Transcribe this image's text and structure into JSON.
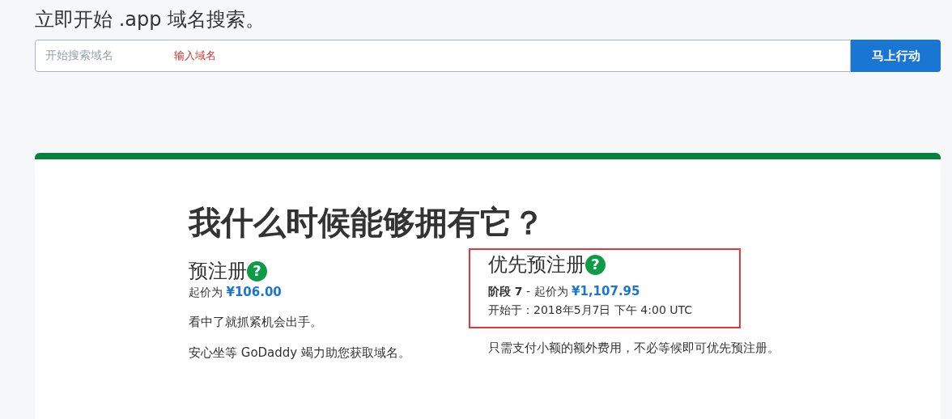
{
  "search": {
    "title": "立即开始 .app 域名搜索。",
    "placeholder": "开始搜索域名",
    "annotation": "输入域名",
    "button": "马上行动"
  },
  "card": {
    "heading": "我什么时候能够拥有它？",
    "plans": [
      {
        "title": "预注册",
        "help_icon": "?",
        "price_label": "起价为",
        "price": "¥106.00",
        "highlighted": false,
        "descriptions": [
          "看中了就抓紧机会出手。",
          "安心坐等 GoDaddy 竭力助您获取域名。"
        ]
      },
      {
        "title": "优先预注册",
        "help_icon": "?",
        "price_label": "**阶段 7** - 起价为",
        "price": "¥1,107.95",
        "start": "开始于：2018年5月7日 下午 4:00 UTC",
        "highlighted": true,
        "descriptions": [
          "只需支付小额的额外费用，不必等候即可优先预注册。"
        ]
      }
    ]
  }
}
